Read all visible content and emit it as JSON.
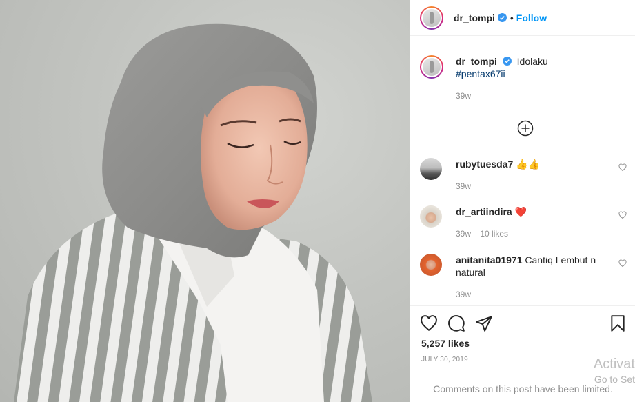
{
  "post": {
    "username": "dr_tompi",
    "follow_label": "Follow",
    "dot": "•"
  },
  "caption": {
    "username": "dr_tompi",
    "text": "Idolaku",
    "hashtag": "#pentax67ii",
    "time": "39w"
  },
  "comments": [
    {
      "username": "rubytuesda7",
      "text": "👍👍",
      "time": "39w",
      "likes": ""
    },
    {
      "username": "dr_artiindira",
      "text": "❤️",
      "time": "39w",
      "likes": "10 likes"
    },
    {
      "username": "anitanita01971",
      "text": "Cantiq Lembut n natural",
      "time": "39w",
      "likes": ""
    }
  ],
  "footer": {
    "likes": "5,257 likes",
    "date": "JULY 30, 2019",
    "limited": "Comments on this post have been limited."
  },
  "watermark": {
    "line1": "Activat",
    "line2": "Go to Set"
  },
  "icons": {
    "verified": "verified-badge-icon",
    "load_more": "plus-circle-icon",
    "like": "heart-icon",
    "comment": "comment-bubble-icon",
    "share": "paper-plane-icon",
    "save": "bookmark-icon"
  },
  "colors": {
    "link": "#0095f6",
    "hashtag": "#00376b",
    "muted": "#8e8e8e",
    "verified": "#3897f0"
  }
}
